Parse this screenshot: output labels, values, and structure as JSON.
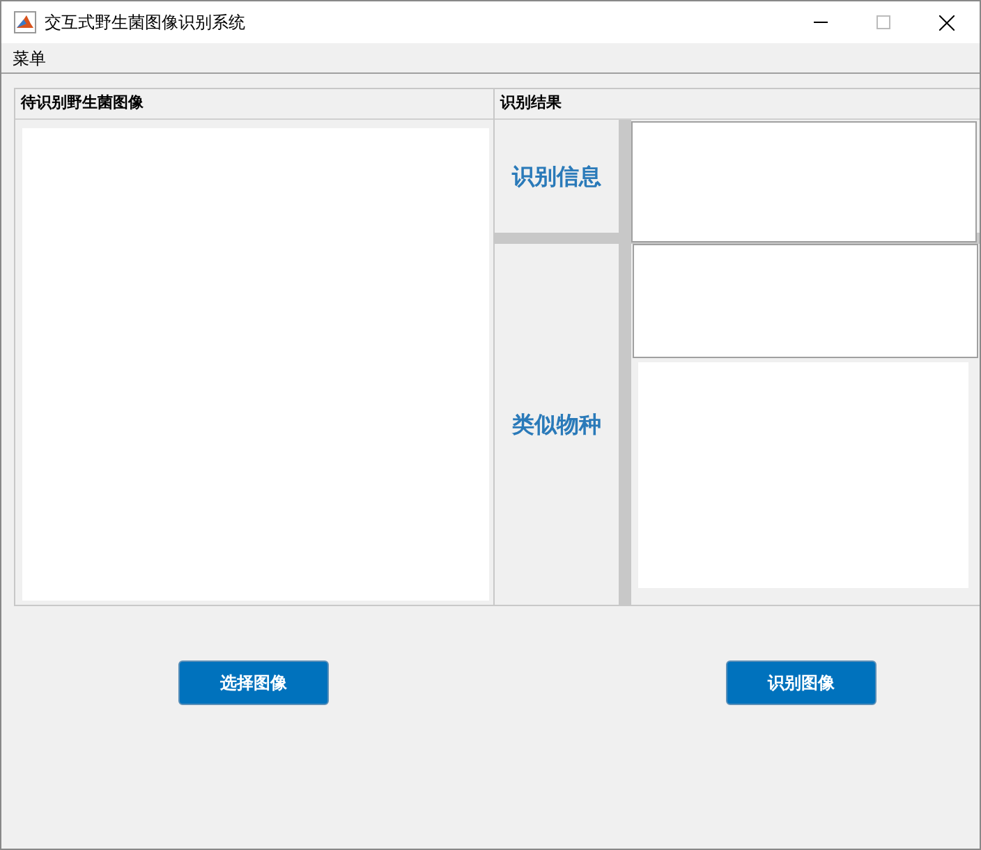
{
  "window": {
    "title": "交互式野生菌图像识别系统"
  },
  "menu": [
    {
      "label": "菜单"
    }
  ],
  "image_panel": {
    "title": "待识别野生菌图像"
  },
  "result_panel": {
    "title": "识别结果",
    "rows": [
      {
        "label": "识别信息",
        "kind": "single"
      },
      {
        "label": "类似物种",
        "kind": "double"
      }
    ]
  },
  "buttons": [
    {
      "label": "选择图像"
    },
    {
      "label": "识别图像"
    }
  ]
}
